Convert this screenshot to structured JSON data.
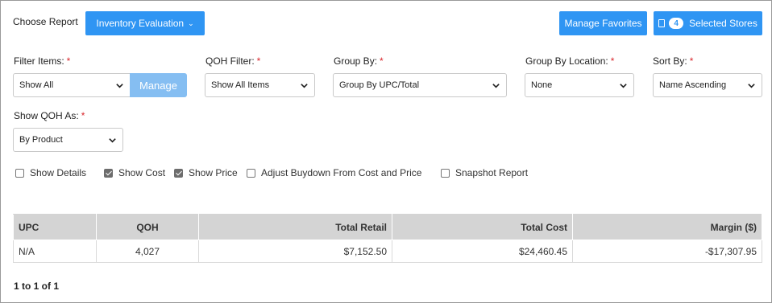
{
  "header": {
    "choose_report_label": "Choose Report",
    "report_selector_label": "Inventory Evaluation",
    "manage_favorites_label": "Manage Favorites",
    "selected_stores_count": "4",
    "selected_stores_label": "Selected Stores"
  },
  "filters": {
    "filter_items": {
      "label": "Filter Items:",
      "required": "*",
      "value": "Show All",
      "manage_label": "Manage"
    },
    "qoh_filter": {
      "label": "QOH Filter:",
      "required": "*",
      "value": "Show All Items"
    },
    "group_by": {
      "label": "Group By:",
      "required": "*",
      "value": "Group By UPC/Total"
    },
    "group_by_location": {
      "label": "Group By Location:",
      "required": "*",
      "value": "None"
    },
    "sort_by": {
      "label": "Sort By:",
      "required": "*",
      "value": "Name Ascending"
    },
    "show_qoh_as": {
      "label": "Show QOH As:",
      "required": "*",
      "value": "By Product"
    }
  },
  "options": [
    {
      "label": "Show Details",
      "checked": false
    },
    {
      "label": "Show Cost",
      "checked": true
    },
    {
      "label": "Show Price",
      "checked": true
    },
    {
      "label": "Adjust Buydown From Cost and Price",
      "checked": false
    },
    {
      "label": "Snapshot Report",
      "checked": false
    }
  ],
  "table": {
    "columns": [
      "UPC",
      "QOH",
      "Total Retail",
      "Total Cost",
      "Margin ($)"
    ],
    "rows": [
      [
        "N/A",
        "4,027",
        "$7,152.50",
        "$24,460.45",
        "-$17,307.95"
      ]
    ]
  },
  "pagination": {
    "label": "1 to 1 of 1"
  },
  "colors": {
    "accent": "#2f95f3",
    "manage_button": "#85bef2",
    "required": "#d9262c",
    "header_bg": "#d4d4d4"
  }
}
